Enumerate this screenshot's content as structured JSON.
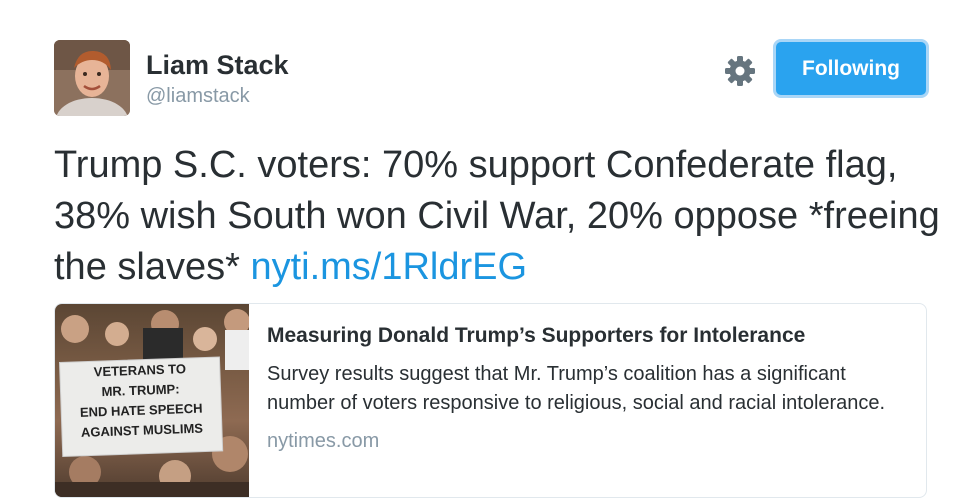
{
  "user": {
    "name": "Liam Stack",
    "handle": "@liamstack"
  },
  "actions": {
    "follow_label": "Following",
    "settings_icon": "gear-icon"
  },
  "tweet": {
    "text_main": "Trump S.C. voters: 70% support Confederate flag, 38% wish South won Civil War, 20% oppose *freeing the slaves* ",
    "link_text": "nyti.ms/1RldrEG"
  },
  "card": {
    "title": "Measuring Donald Trump’s Supporters for Intolerance",
    "description": "Survey results suggest that Mr. Trump’s coalition has a significant number of voters responsive to religious, social and racial intolerance.",
    "domain": "nytimes.com",
    "image_sign_lines": [
      "VETERANS TO",
      "MR. TRUMP:",
      "END HATE SPEECH",
      "AGAINST MUSLIMS"
    ]
  },
  "colors": {
    "follow_button": "#2aa3ef",
    "link": "#1b95e0",
    "secondary_text": "#8899a6"
  }
}
